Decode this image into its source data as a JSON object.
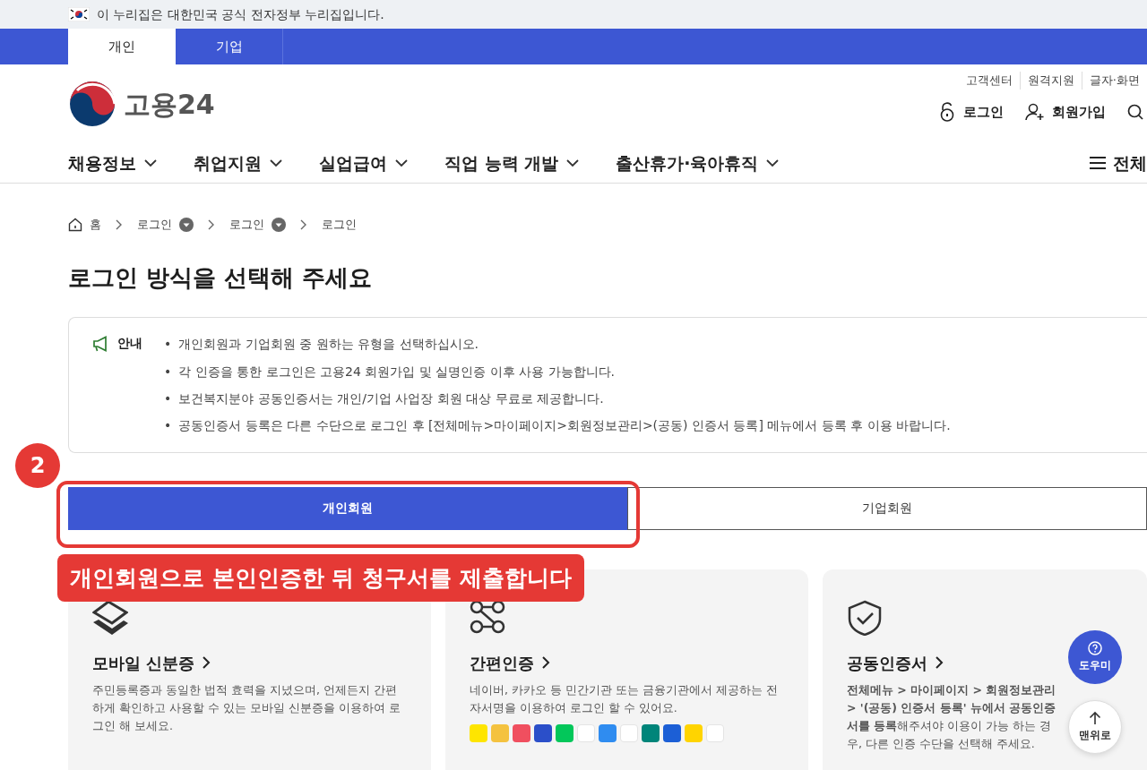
{
  "gov_banner": {
    "text": "이 누리집은 대한민국 공식 전자정부 누리집입니다."
  },
  "member_tabs": [
    {
      "label": "개인",
      "selected": true
    },
    {
      "label": "기업",
      "selected": false
    }
  ],
  "logo": {
    "text": "고용24"
  },
  "utility_links": [
    "고객센터",
    "원격지원",
    "글자·화면"
  ],
  "account_links": [
    {
      "kind": "login",
      "label": "로그인"
    },
    {
      "kind": "signup",
      "label": "회원가입"
    }
  ],
  "main_nav": [
    {
      "label": "채용정보"
    },
    {
      "label": "취업지원"
    },
    {
      "label": "실업급여"
    },
    {
      "label": "직업 능력 개발"
    },
    {
      "label": "출산휴가·육아휴직"
    }
  ],
  "all_menu": {
    "label": "전체"
  },
  "breadcrumb": [
    {
      "kind": "home",
      "label": "홈"
    },
    {
      "kind": "dropdown",
      "label": "로그인"
    },
    {
      "kind": "dropdown",
      "label": "로그인"
    },
    {
      "kind": "current",
      "label": "로그인"
    }
  ],
  "page_title": "로그인 방식을 선택해 주세요",
  "notice": {
    "label": "안내",
    "items": [
      {
        "bullet": "•",
        "text": "개인회원과 기업회원 중 원하는 유형을 선택하십시오."
      },
      {
        "bullet": "•",
        "text": "각 인증을 통한 로그인은 고용24 회원가입 및 실명인증 이후 사용 가능합니다."
      },
      {
        "bullet": "•",
        "text": "보건복지분야 공동인증서는 개인/기업 사업장 회원 대상 무료로 제공합니다."
      },
      {
        "bullet": "•",
        "text": "공동인증서 등록은 다른 수단으로 로그인 후 [전체메뉴>마이페이지>회원정보관리>(공동) 인증서 등록] 메뉴에서 등록 후 이용 바랍니다."
      }
    ]
  },
  "login_tabs": [
    {
      "label": "개인회원",
      "selected": true
    },
    {
      "label": "기업회원",
      "selected": false
    }
  ],
  "methods": [
    {
      "kind": "mobile-id",
      "title": "모바일 신분증",
      "description": [
        "주민등록증과 동일한 법적 효력을 지녔으며, 언제든지 간편하게 확인하고 사용할 수 있는 모바일 신분증을 이용하여 로그인 해 보세요."
      ]
    },
    {
      "kind": "simple",
      "title": "간편인증",
      "description": [
        "네이버, 카카오 등 민간기관 또는 금융기관에서 제공하는 전자서명을 이용하여 로그인 할 수 있어요."
      ],
      "providers": [
        {
          "color": "#fee500"
        },
        {
          "color": "#f4c23f"
        },
        {
          "color": "#f04f5f"
        },
        {
          "color": "#2b4fc9"
        },
        {
          "color": "#03c75a"
        },
        {
          "color": "#ffffff"
        },
        {
          "color": "#2f8cf0"
        },
        {
          "color": "#ffffff"
        },
        {
          "color": "#00857a"
        },
        {
          "color": "#1c5fd6"
        },
        {
          "color": "#ffd400"
        },
        {
          "color": "#ffffff"
        }
      ]
    },
    {
      "kind": "certificate",
      "title": "공동인증서",
      "description": [
        "**전체메뉴 > 마이페이지 > 회원정보관리 > '(공동) 인증서 등록' 뉴에서 공동인증서를 등록**해주셔야 이용이 가능 하는 경우, 다른 인증 수단을 선택해 주세요."
      ]
    }
  ],
  "floating_buttons": [
    {
      "kind": "help",
      "label": "도우미"
    },
    {
      "kind": "top",
      "label": "맨위로"
    }
  ],
  "annotations": [
    {
      "kind": "step",
      "text": "2"
    },
    {
      "kind": "highlight"
    },
    {
      "kind": "caption",
      "text": "개인회원으로 본인인증한 뒤 청구서를 제출합니다"
    }
  ]
}
